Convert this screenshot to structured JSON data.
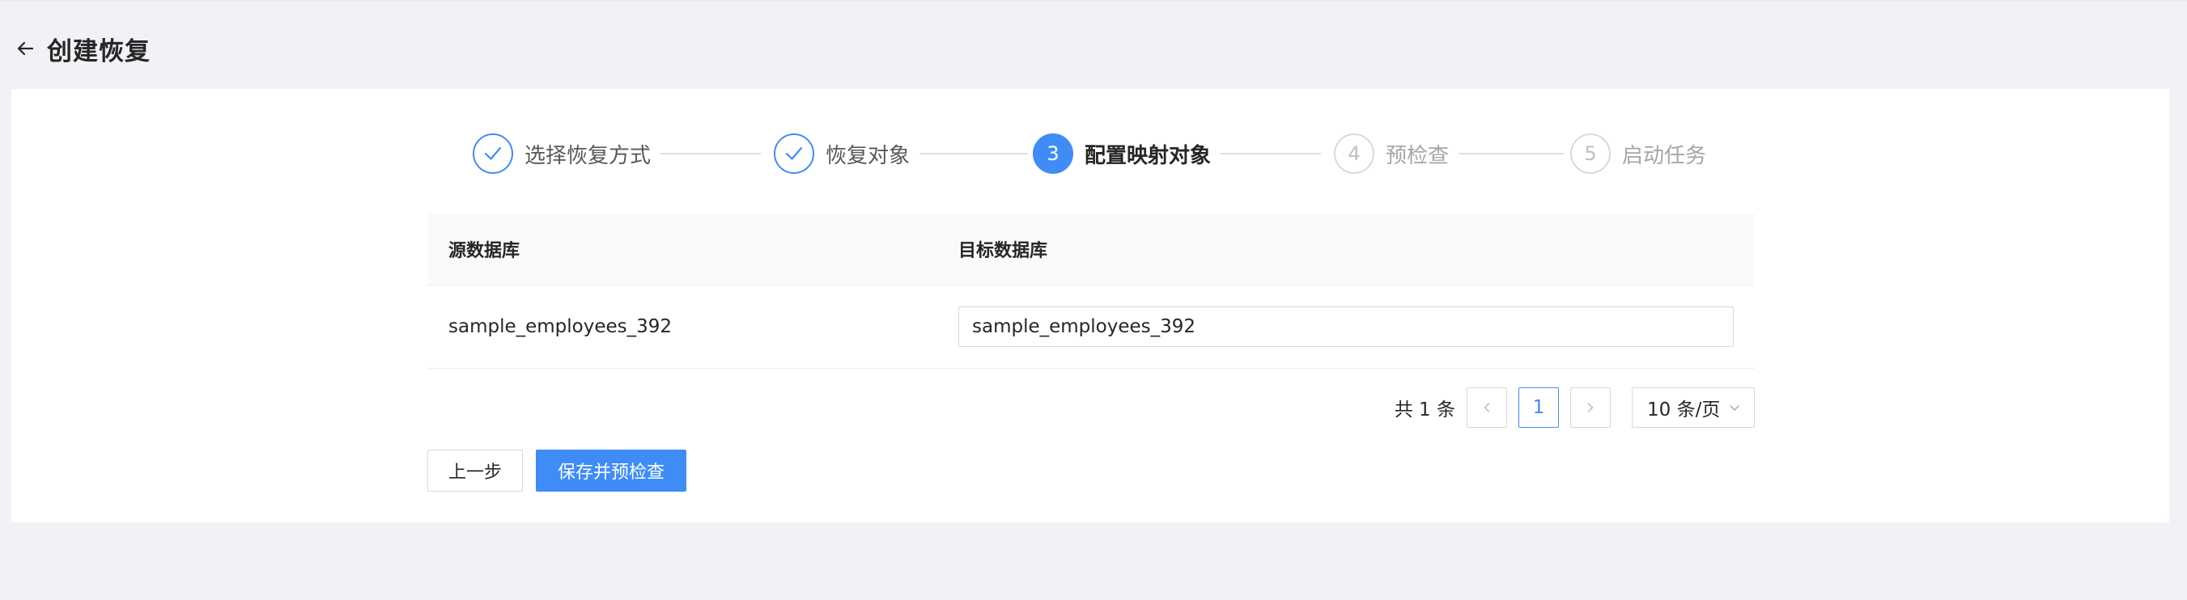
{
  "header": {
    "title": "创建恢复"
  },
  "steps": [
    {
      "label": "选择恢复方式",
      "status": "done",
      "number": "1"
    },
    {
      "label": "恢复对象",
      "status": "done",
      "number": "2"
    },
    {
      "label": "配置映射对象",
      "status": "active",
      "number": "3"
    },
    {
      "label": "预检查",
      "status": "wait",
      "number": "4"
    },
    {
      "label": "启动任务",
      "status": "wait",
      "number": "5"
    }
  ],
  "table": {
    "columns": [
      "源数据库",
      "目标数据库"
    ],
    "rows": [
      {
        "source": "sample_employees_392",
        "target": "sample_employees_392"
      }
    ]
  },
  "pagination": {
    "total_text": "共 1 条",
    "current_page": "1",
    "page_size": "10 条/页"
  },
  "actions": {
    "prev_label": "上一步",
    "save_label": "保存并预检查"
  },
  "colors": {
    "primary": "#3f8cf7",
    "background": "#f0f2f5"
  }
}
